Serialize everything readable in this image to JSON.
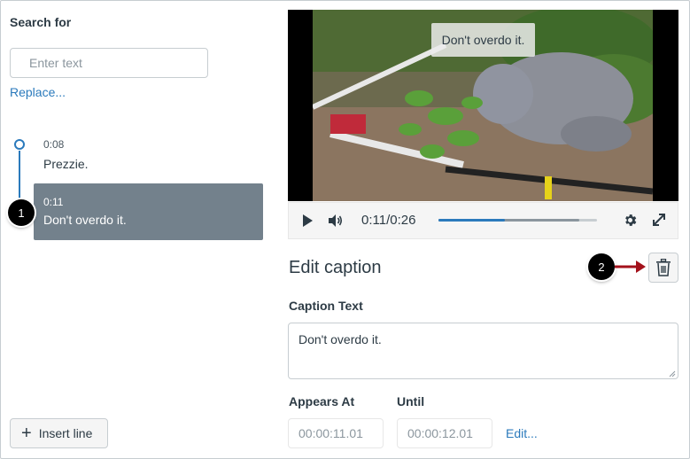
{
  "search": {
    "label": "Search for",
    "placeholder": "Enter text",
    "replace_link": "Replace..."
  },
  "captions": [
    {
      "time": "0:08",
      "text": "Prezzie."
    },
    {
      "time": "0:11",
      "text": "Don't overdo it."
    }
  ],
  "markers": [
    "1",
    "2"
  ],
  "insert_line_label": "Insert line",
  "video": {
    "overlay_caption": "Don't overdo it.",
    "time_display": "0:11/0:26",
    "progress_fraction": 0.42,
    "buffered_fraction": 0.89
  },
  "edit": {
    "title": "Edit caption",
    "caption_text_label": "Caption Text",
    "caption_text_value": "Don't overdo it.",
    "appears_at_label": "Appears At",
    "appears_at_value": "00:00:11.01",
    "until_label": "Until",
    "until_value": "00:00:12.01",
    "edit_link": "Edit..."
  },
  "colors": {
    "accent": "#2b7abc",
    "selected_row": "#73818c",
    "callout_arrow": "#a3111b"
  },
  "icons": [
    "play-icon",
    "volume-icon",
    "gear-icon",
    "fullscreen-icon",
    "trash-icon",
    "plus-icon"
  ]
}
